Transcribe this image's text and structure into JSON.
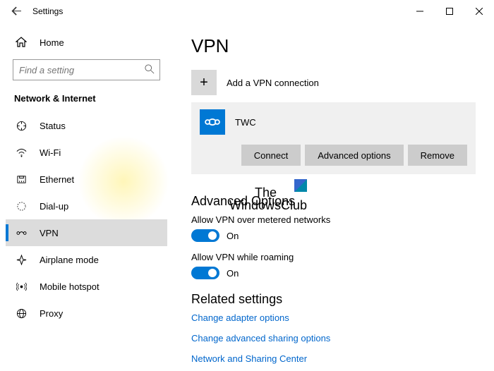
{
  "title": "Settings",
  "sidebar": {
    "home": "Home",
    "search_placeholder": "Find a setting",
    "section": "Network & Internet",
    "items": [
      {
        "label": "Status"
      },
      {
        "label": "Wi-Fi"
      },
      {
        "label": "Ethernet"
      },
      {
        "label": "Dial-up"
      },
      {
        "label": "VPN"
      },
      {
        "label": "Airplane mode"
      },
      {
        "label": "Mobile hotspot"
      },
      {
        "label": "Proxy"
      }
    ]
  },
  "content": {
    "page_title": "VPN",
    "add_label": "Add a VPN connection",
    "vpn_name": "TWC",
    "connect": "Connect",
    "advanced": "Advanced options",
    "remove": "Remove",
    "adv_header": "Advanced Options",
    "opt1_label": "Allow VPN over metered networks",
    "opt1_state": "On",
    "opt2_label": "Allow VPN while roaming",
    "opt2_state": "On",
    "related_header": "Related settings",
    "link1": "Change adapter options",
    "link2": "Change advanced sharing options",
    "link3": "Network and Sharing Center"
  },
  "watermark": {
    "line1": "The",
    "line2": "WindowsClub"
  }
}
